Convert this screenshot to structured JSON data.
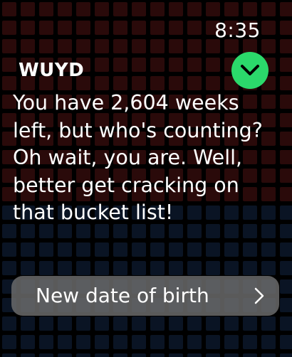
{
  "status": {
    "time": "8:35"
  },
  "app": {
    "title": "WUYD"
  },
  "message": {
    "text": "You have 2,604 weeks left, but who's counting? Oh wait, you are. Well, better get cracking on that bucket list!"
  },
  "actions": {
    "new_dob_label": "New date of birth"
  },
  "icons": {
    "confirm": "checkmark-chevron-icon",
    "next": "chevron-right-icon"
  },
  "colors": {
    "background": "#000000",
    "confirm_green": "#2bd96b",
    "button_gray": "#6e6e6e",
    "grid_red": "#2a0a0a",
    "grid_blue": "#0a1424"
  }
}
